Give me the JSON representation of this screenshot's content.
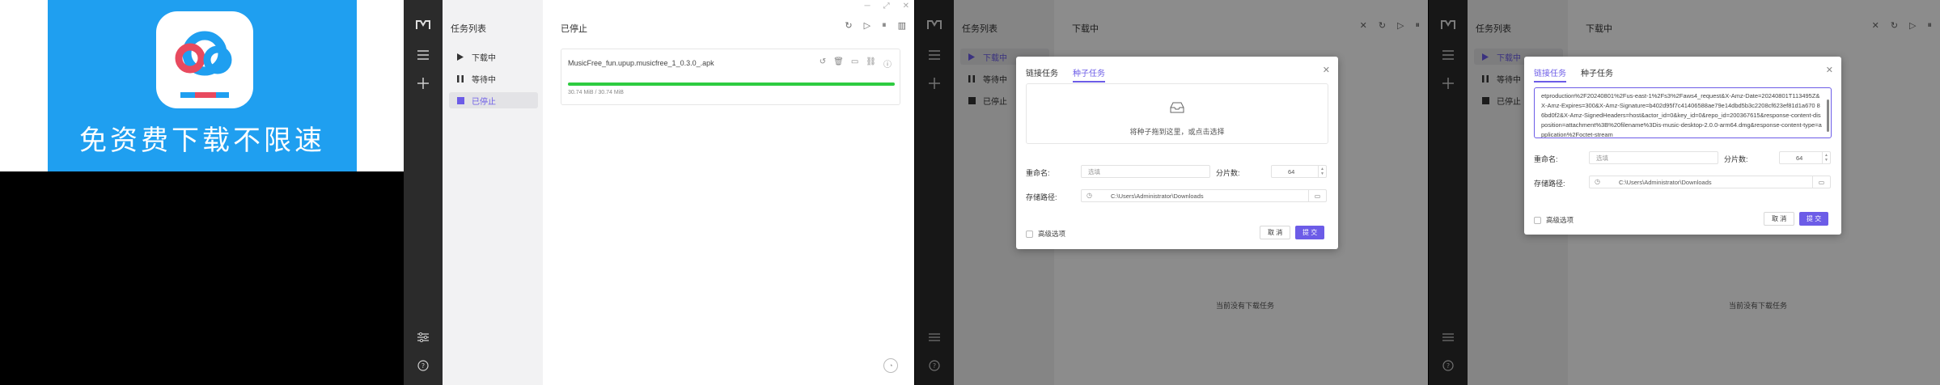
{
  "promo": {
    "slogan": "免资费下载不限速"
  },
  "rail": {
    "logo": "m-logo-icon",
    "icons": [
      "menu-icon",
      "plus-icon",
      "sliders-icon",
      "help-icon"
    ]
  },
  "window1": {
    "panel_title": "任务列表",
    "nav": [
      {
        "label": "下载中",
        "icon": "play-icon"
      },
      {
        "label": "等待中",
        "icon": "pause-icon"
      },
      {
        "label": "已停止",
        "icon": "stop-icon"
      }
    ],
    "main_title": "已停止",
    "task": {
      "name": "MusicFree_fun.upup.musicfree_1_0.3.0_.apk",
      "progress": 1.0,
      "progress_color": "#2ecc40",
      "size": "30.74 MiB / 30.74 MiB"
    }
  },
  "window2": {
    "panel_title": "任务列表",
    "main_title": "下载中",
    "nav": [
      {
        "label": "下载中",
        "icon": "play-icon"
      },
      {
        "label": "等待中",
        "icon": "pause-icon"
      },
      {
        "label": "已停止",
        "icon": "stop-icon"
      }
    ],
    "empty_text": "当前没有下载任务",
    "dialog": {
      "tabs": [
        "链接任务",
        "种子任务"
      ],
      "active_tab": "种子任务",
      "dropzone_text": "将种子拖到这里，或点击选择",
      "rename_label": "重命名:",
      "rename_placeholder": "选填",
      "split_label": "分片数:",
      "split_value": "64",
      "path_label": "存储路径:",
      "path_value": "C:\\Users\\Administrator\\Downloads",
      "advanced_label": "高级选项",
      "cancel_label": "取 消",
      "submit_label": "提 交"
    }
  },
  "window3": {
    "panel_title": "任务列表",
    "main_title": "下载中",
    "nav": [
      {
        "label": "下载中",
        "icon": "play-icon"
      },
      {
        "label": "等待中",
        "icon": "pause-icon"
      },
      {
        "label": "已停止",
        "icon": "stop-icon"
      }
    ],
    "empty_text": "当前没有下载任务",
    "dialog": {
      "tabs": [
        "链接任务",
        "种子任务"
      ],
      "active_tab": "链接任务",
      "url_text": "etproduction%2F20240801%2Fus-east-1%2Fs3%2Faws4_request&X-Amz-Date=20240801T113495Z&X-Amz-Expires=300&X-Amz-Signature=b402d95f7c41406588ae79e14dbd5b3c2208cf623ef81d1a670 86bd0f2&X-Amz-SignedHeaders=host&actor_id=0&key_id=0&repo_id=200367615&response-content-disposition=attachment%3B%20filename%3Dis-music-desktop-2.0.0-arm64.dmg&response-content-type=application%2Foctet-stream",
      "rename_label": "重命名:",
      "rename_placeholder": "选填",
      "split_label": "分片数:",
      "split_value": "64",
      "path_label": "存储路径:",
      "path_value": "C:\\Users\\Administrator\\Downloads",
      "advanced_label": "高级选项",
      "cancel_label": "取 消",
      "submit_label": "提 交"
    }
  },
  "colors": {
    "accent": "#6c5ce7",
    "rail_bg": "#2b2b2b",
    "promo_blue": "#1f9ff0",
    "progress_green": "#2ecc40"
  }
}
